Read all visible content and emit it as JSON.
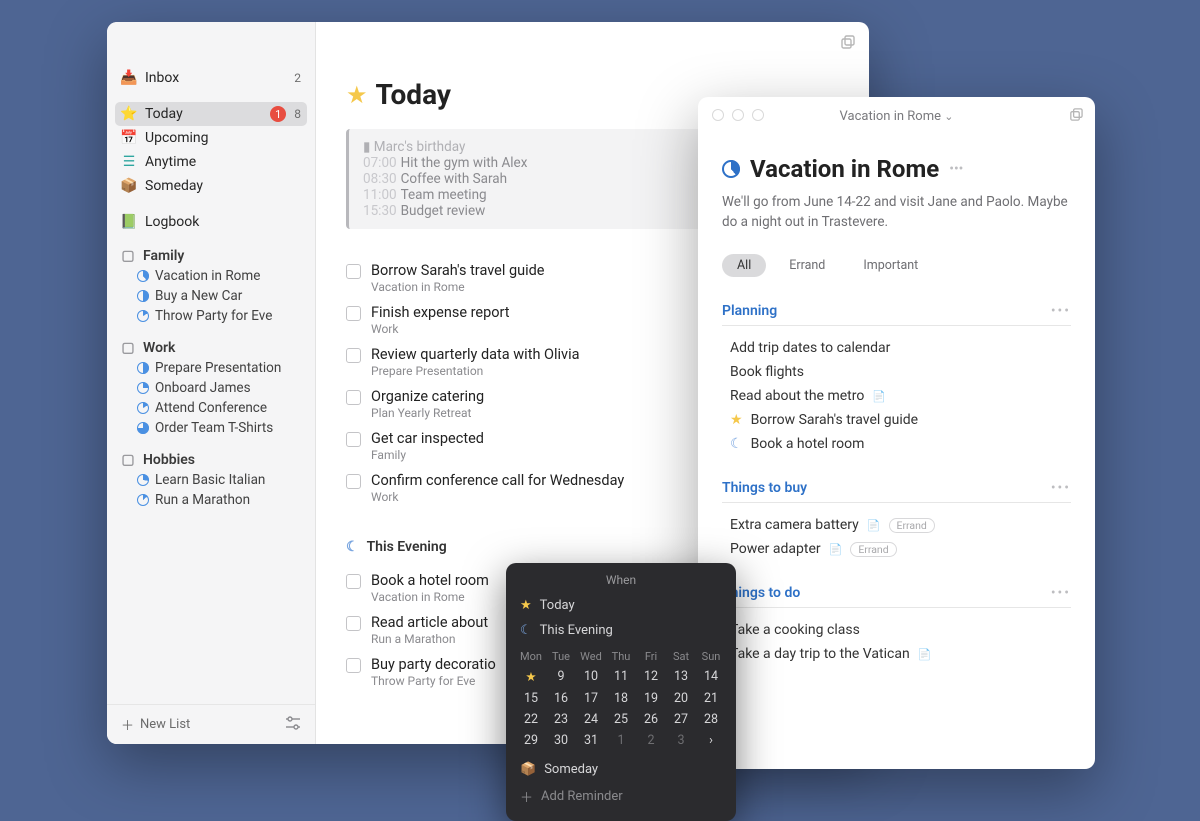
{
  "sidebar": {
    "inbox": {
      "label": "Inbox",
      "count": "2"
    },
    "today": {
      "label": "Today",
      "red": "1",
      "count": "8"
    },
    "upcoming": {
      "label": "Upcoming"
    },
    "anytime": {
      "label": "Anytime"
    },
    "someday": {
      "label": "Someday"
    },
    "logbook": {
      "label": "Logbook"
    },
    "areas": [
      {
        "name": "Family",
        "projects": [
          {
            "name": "Vacation in Rome",
            "p": 140
          },
          {
            "name": "Buy a New Car",
            "p": 180
          },
          {
            "name": "Throw Party for Eve",
            "p": 60
          }
        ]
      },
      {
        "name": "Work",
        "projects": [
          {
            "name": "Prepare Presentation",
            "p": 180
          },
          {
            "name": "Onboard James",
            "p": 90
          },
          {
            "name": "Attend Conference",
            "p": 60
          },
          {
            "name": "Order Team T-Shirts",
            "p": 270
          }
        ]
      },
      {
        "name": "Hobbies",
        "projects": [
          {
            "name": "Learn Basic Italian",
            "p": 100
          },
          {
            "name": "Run a Marathon",
            "p": 50
          }
        ]
      }
    ],
    "new_list": "New List"
  },
  "today": {
    "title": "Today",
    "events": {
      "birthday": "Marc's birthday",
      "items": [
        {
          "time": "07:00",
          "text": "Hit the gym with Alex"
        },
        {
          "time": "08:30",
          "text": "Coffee with Sarah"
        },
        {
          "time": "11:00",
          "text": "Team meeting"
        },
        {
          "time": "15:30",
          "text": "Budget review"
        }
      ]
    },
    "tasks": [
      {
        "title": "Borrow Sarah's travel guide",
        "sub": "Vacation in Rome"
      },
      {
        "title": "Finish expense report",
        "sub": "Work"
      },
      {
        "title": "Review quarterly data with Olivia",
        "sub": "Prepare Presentation"
      },
      {
        "title": "Organize catering",
        "sub": "Plan Yearly Retreat"
      },
      {
        "title": "Get car inspected",
        "sub": "Family"
      },
      {
        "title": "Confirm conference call for Wednesday",
        "sub": "Work"
      }
    ],
    "evening_title": "This Evening",
    "evening": [
      {
        "title": "Book a hotel room",
        "sub": "Vacation in Rome"
      },
      {
        "title": "Read article about",
        "sub": "Run a Marathon"
      },
      {
        "title": "Buy party decoratio",
        "sub": "Throw Party for Eve"
      }
    ]
  },
  "project": {
    "window_title": "Vacation in Rome",
    "title": "Vacation in Rome",
    "note": "We'll go from June 14-22 and visit Jane and Paolo. Maybe do a night out in Trastevere.",
    "filters": {
      "all": "All",
      "errand": "Errand",
      "important": "Important"
    },
    "sections": [
      {
        "title": "Planning",
        "items": [
          {
            "title": "Add trip dates to calendar"
          },
          {
            "title": "Book flights"
          },
          {
            "title": "Read about the metro",
            "note": true
          },
          {
            "title": "Borrow Sarah's travel guide",
            "star": true
          },
          {
            "title": "Book a hotel room",
            "moon": true
          }
        ]
      },
      {
        "title": "Things to buy",
        "items": [
          {
            "title": "Extra camera battery",
            "note": true,
            "tag": "Errand"
          },
          {
            "title": "Power adapter",
            "note": true,
            "tag": "Errand"
          }
        ]
      },
      {
        "title": "Things to do",
        "items": [
          {
            "title": "Take a cooking class"
          },
          {
            "title": "Take a day trip to the Vatican",
            "note": true
          }
        ]
      }
    ]
  },
  "popover": {
    "header": "When",
    "today": "Today",
    "evening": "This Evening",
    "days": [
      "Mon",
      "Tue",
      "Wed",
      "Thu",
      "Fri",
      "Sat",
      "Sun"
    ],
    "weeks": [
      [
        "★",
        "9",
        "10",
        "11",
        "12",
        "13",
        "14"
      ],
      [
        "15",
        "16",
        "17",
        "18",
        "19",
        "20",
        "21"
      ],
      [
        "22",
        "23",
        "24",
        "25",
        "26",
        "27",
        "28"
      ],
      [
        "29",
        "30",
        "31",
        "1",
        "2",
        "3",
        "›"
      ]
    ],
    "someday": "Someday",
    "reminder": "Add Reminder"
  }
}
